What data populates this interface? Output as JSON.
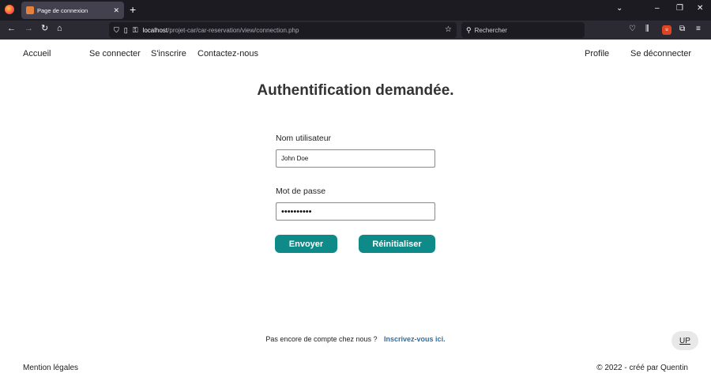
{
  "browser": {
    "tab_title": "Page de connexion",
    "url_host": "localhost",
    "url_path": "/projet-car/car-reservation/view/connection.php",
    "search_placeholder": "Rechercher"
  },
  "nav": {
    "home": "Accueil",
    "login": "Se connecter",
    "register": "S'inscrire",
    "contact": "Contactez-nous",
    "profile": "Profile",
    "logout": "Se déconnecter"
  },
  "form": {
    "heading": "Authentification demandée.",
    "username_label": "Nom utilisateur",
    "username_value": "John Doe",
    "password_label": "Mot de passe",
    "password_value": "••••••••••",
    "submit_label": "Envoyer",
    "reset_label": "Réinitialiser"
  },
  "signup": {
    "prompt": "Pas encore de compte chez nous ?",
    "link": "Inscrivez-vous ici."
  },
  "up_label": "UP",
  "footer": {
    "left": "Mention légales",
    "right": "© 2022 - créé par Quentin"
  },
  "colors": {
    "button": "#0e8a88",
    "link": "#2d6fa8"
  }
}
